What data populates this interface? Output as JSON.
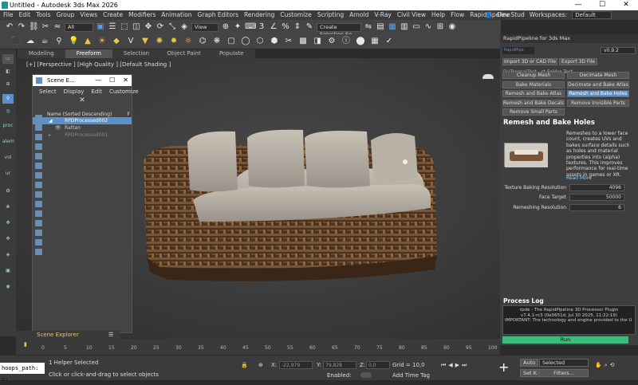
{
  "window": {
    "title": "Untitled - Autodesk 3ds Max 2026",
    "minimize": "—",
    "maximize": "☐",
    "close": "✕"
  },
  "menu": [
    "File",
    "Edit",
    "Tools",
    "Group",
    "Views",
    "Create",
    "Modifiers",
    "Animation",
    "Graph Editors",
    "Rendering",
    "Customize",
    "Scripting",
    "Arnold",
    "V-Ray",
    "Civil View",
    "Help",
    "Flow",
    "RapidPipeline"
  ],
  "user": {
    "name": "Dev Stud",
    "workspace_label": "Workspaces:",
    "workspace_value": "Default"
  },
  "toolbar": {
    "filter_value": "All",
    "view_value": "View",
    "selection_set_placeholder": "Create Selection Se"
  },
  "ribbon_tabs": [
    "Modeling",
    "Freeform",
    "Selection",
    "Object Paint",
    "Populate"
  ],
  "ribbon_active": "Freeform",
  "viewport": {
    "label": "[+] [Perspective ] [High Quality ] [Default Shading ]"
  },
  "left_toolbar": [
    "proc",
    "alem",
    "vol",
    "ur"
  ],
  "scene_explorer": {
    "title": "Scene E...",
    "menu": [
      "Select",
      "Display",
      "Edit",
      "Customize"
    ],
    "column_header": "Name (Sorted Descending)",
    "column_header_right": "F",
    "rows": [
      {
        "name": "RPDProcessed002",
        "selected": true
      },
      {
        "name": "Rattan",
        "selected": false
      },
      {
        "name": "RPDProcessed001",
        "selected": false
      }
    ],
    "footer_label": "Scene Explorer"
  },
  "rapid_panel": {
    "title": "RapidPipeline for 3ds Max",
    "logo_text": "RapidPipe",
    "version": "v0.9.2",
    "buttons": {
      "import": "Import 3D or CAD File",
      "export": "Export 3D File",
      "cleanup": "Cleanup Mesh",
      "decimate": "Decimate Mesh",
      "bake_materials": "Bake Materials",
      "decimate_bake": "Decimate and Bake Atlas",
      "remesh_bake_atlas": "Remesh and Bake Atlas",
      "remesh_bake_holes": "Remesh and Bake Holes",
      "remesh_bake_decals": "Remesh and Bake Decals",
      "remove_invisible": "Remove Invisible Parts",
      "remove_small": "Remove Small Parts"
    },
    "path": "D:\\Teresa\\Test...ct Folder Test",
    "section_title": "Remesh and Bake Holes",
    "description": "Remeshes to a lower face count, creates UVs and bakes surface details such as holes and material properties into (alpha) textures. This improves performance for real-time assets in games or XR.",
    "read_more": "Read More",
    "params": [
      {
        "label": "Texture Baking Resolution",
        "value": "4096"
      },
      {
        "label": "Face Target",
        "value": "50000"
      },
      {
        "label": "Remeshing Resolution",
        "value": "6"
      }
    ],
    "process_log_title": "Process Log",
    "log_lines": [
      "rpde - The RapidPipeline 3D Processor Plugin",
      "v7.4.1-rc5 (0e0651d, Jul 30 2025, 11:22:19)",
      "IMPORTANT: The technology and engine provided to the U"
    ],
    "run_label": "Run"
  },
  "timeline": {
    "ticks": [
      "0",
      "5",
      "10",
      "15",
      "20",
      "25",
      "30",
      "35",
      "40",
      "45",
      "50",
      "55",
      "60",
      "65",
      "70",
      "75",
      "80",
      "85",
      "90",
      "95",
      "100"
    ]
  },
  "status": {
    "maxscript": "hoops_path: c:",
    "helper": "1 Helper Selected",
    "prompt": "Click or click-and-drag to select objects",
    "x_label": "X:",
    "x_value": "-22,979",
    "y_label": "Y:",
    "y_value": "79,828",
    "z_label": "Z:",
    "z_value": "0,0",
    "grid": "Grid = 10,0",
    "enabled_label": "Enabled:",
    "add_time_tag": "Add Time Tag",
    "auto": "Auto",
    "set_k": "Set K.",
    "selected": "Selected",
    "filters": "Filters..."
  },
  "colors": {
    "accent": "#5b8fc7",
    "run": "#3dbb7a",
    "gold": "#f0c64a"
  }
}
